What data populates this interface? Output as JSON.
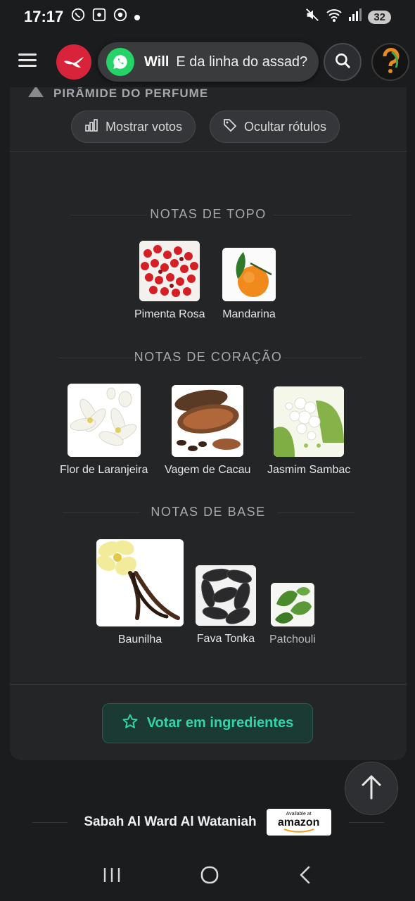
{
  "status_bar": {
    "time": "17:17",
    "battery": "32"
  },
  "header": {
    "toast_sender": "Will",
    "toast_message": "E da linha do assad?"
  },
  "card": {
    "title": "PIRÂMIDE DO PERFUME",
    "show_votes_label": "Mostrar votos",
    "hide_labels_label": "Ocultar rótulos",
    "sections": [
      {
        "title": "NOTAS DE TOPO",
        "notes": [
          "Pimenta Rosa",
          "Mandarina"
        ]
      },
      {
        "title": "NOTAS DE CORAÇÃO",
        "notes": [
          "Flor de Laranjeira",
          "Vagem de Cacau",
          "Jasmim Sambac"
        ]
      },
      {
        "title": "NOTAS DE BASE",
        "notes": [
          "Baunilha",
          "Fava Tonka",
          "Patchouli"
        ]
      }
    ],
    "vote_button_label": "Votar em ingredientes"
  },
  "footer": {
    "perfume_name": "Sabah Al Ward Al Wataniah",
    "amazon_small": "Available at",
    "amazon_big": "amazon"
  },
  "colors": {
    "accent": "#35d4a8",
    "brand": "#d8243a",
    "whatsapp": "#25d366"
  }
}
